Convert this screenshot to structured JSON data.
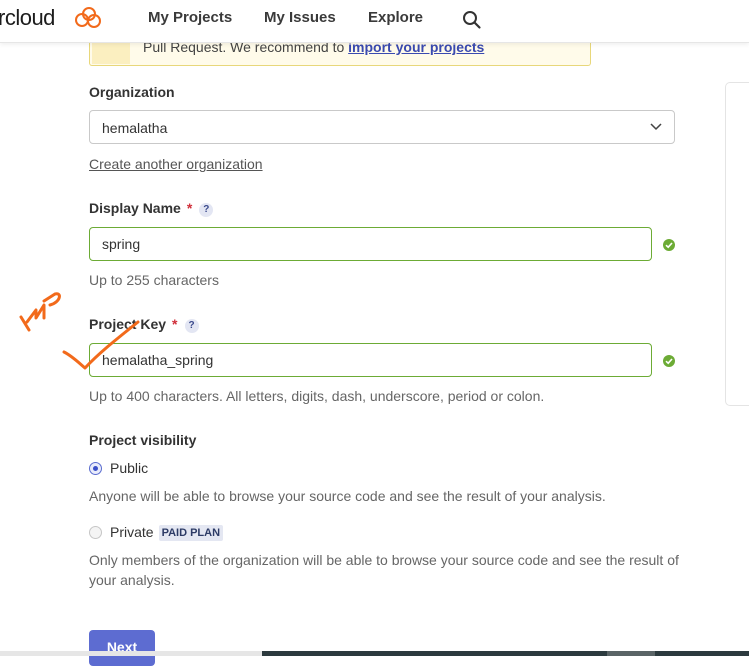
{
  "header": {
    "logo_text": "rcloud",
    "nav": [
      "My Projects",
      "My Issues",
      "Explore"
    ]
  },
  "banner": {
    "text": "Pull Request. We recommend to ",
    "link": "import your projects"
  },
  "form": {
    "organization": {
      "label": "Organization",
      "selected": "hemalatha",
      "create_link": "Create another organization"
    },
    "display_name": {
      "label": "Display Name",
      "required": "*",
      "help": "?",
      "value": "spring",
      "hint": "Up to 255 characters"
    },
    "project_key": {
      "label": "Project Key",
      "required": "*",
      "help": "?",
      "value": "hemalatha_spring",
      "hint": "Up to 400 characters. All letters, digits, dash, underscore, period or colon."
    },
    "visibility": {
      "label": "Project visibility",
      "public_label": "Public",
      "public_desc": "Anyone will be able to browse your source code and see the result of your analysis.",
      "private_label": "Private",
      "private_badge": "PAID PLAN",
      "private_desc": "Only members of the organization will be able to browse your source code and see the result of your analysis.",
      "selected": "Public"
    },
    "next_label": "Next"
  },
  "annotation": {
    "handwritten_text": "KMP"
  },
  "colors": {
    "accent": "#5d6cd1",
    "valid": "#6cab35",
    "required": "#d02f3a",
    "annotation": "#f26a1b",
    "logo": "#f26a1b"
  }
}
